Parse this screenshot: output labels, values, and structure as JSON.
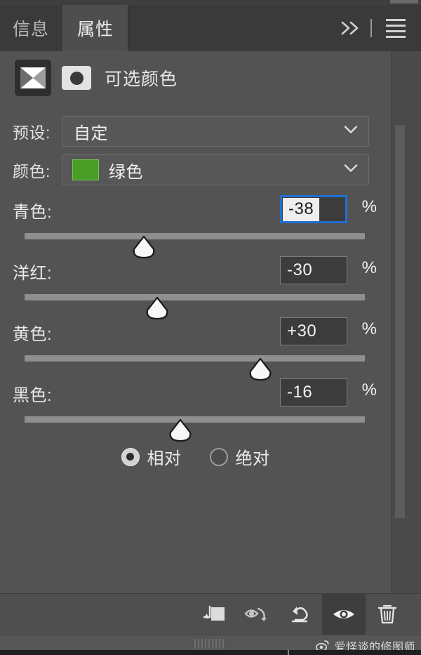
{
  "window": {
    "panel_name": "属性",
    "tabs": [
      {
        "label": "信息",
        "active": false
      },
      {
        "label": "属性",
        "active": true
      }
    ],
    "more_tabs_icon": "double-chevron-right-icon",
    "menu_icon": "hamburger-menu-icon"
  },
  "header": {
    "adjustment_icon": "selective-color-adjustment-icon",
    "mask_icon": "layer-mask-thumbnail-icon",
    "title": "可选颜色"
  },
  "preset": {
    "label": "预设:",
    "value": "自定",
    "caret_icon": "chevron-down-icon"
  },
  "colors": {
    "label": "颜色:",
    "value": "绿色",
    "swatch_hex": "#4a9e28",
    "caret_icon": "chevron-down-icon"
  },
  "sliders": [
    {
      "label": "青色:",
      "value": "-38",
      "numeric": -38,
      "unit": "%",
      "focused": true,
      "thumb_pct": 31.0
    },
    {
      "label": "洋红:",
      "value": "-30",
      "numeric": -30,
      "unit": "%",
      "focused": false,
      "thumb_pct": 35.0
    },
    {
      "label": "黄色:",
      "value": "+30",
      "numeric": 30,
      "unit": "%",
      "focused": false,
      "thumb_pct": 65.0
    },
    {
      "label": "黑色:",
      "value": "-16",
      "numeric": -16,
      "unit": "%",
      "focused": false,
      "thumb_pct": 42.0
    }
  ],
  "method": {
    "options": [
      {
        "label": "相对",
        "selected": true
      },
      {
        "label": "绝对",
        "selected": false
      }
    ]
  },
  "toolbar": {
    "buttons": [
      {
        "name": "clip-to-layer-icon",
        "active": false
      },
      {
        "name": "view-previous-state-icon",
        "active": false
      },
      {
        "name": "reset-adjustment-icon",
        "active": false
      },
      {
        "name": "toggle-visibility-eye-icon",
        "active": true
      },
      {
        "name": "delete-adjustment-trash-icon",
        "active": false
      }
    ]
  },
  "footer": {
    "grip_icon": "resize-grip-icon",
    "watermark_logo": "weibo-logo-icon",
    "watermark_text": "爱怪谈的修图师"
  },
  "theme": {
    "panel_bg": "#535353",
    "tabbar_bg": "#3a3a3a",
    "active_tab_bg": "#4e4e4e",
    "field_bg": "#3c3c3c",
    "focus_border": "#1f6fd6",
    "track": "#8f8f8f",
    "text": "#e8e8e8"
  }
}
